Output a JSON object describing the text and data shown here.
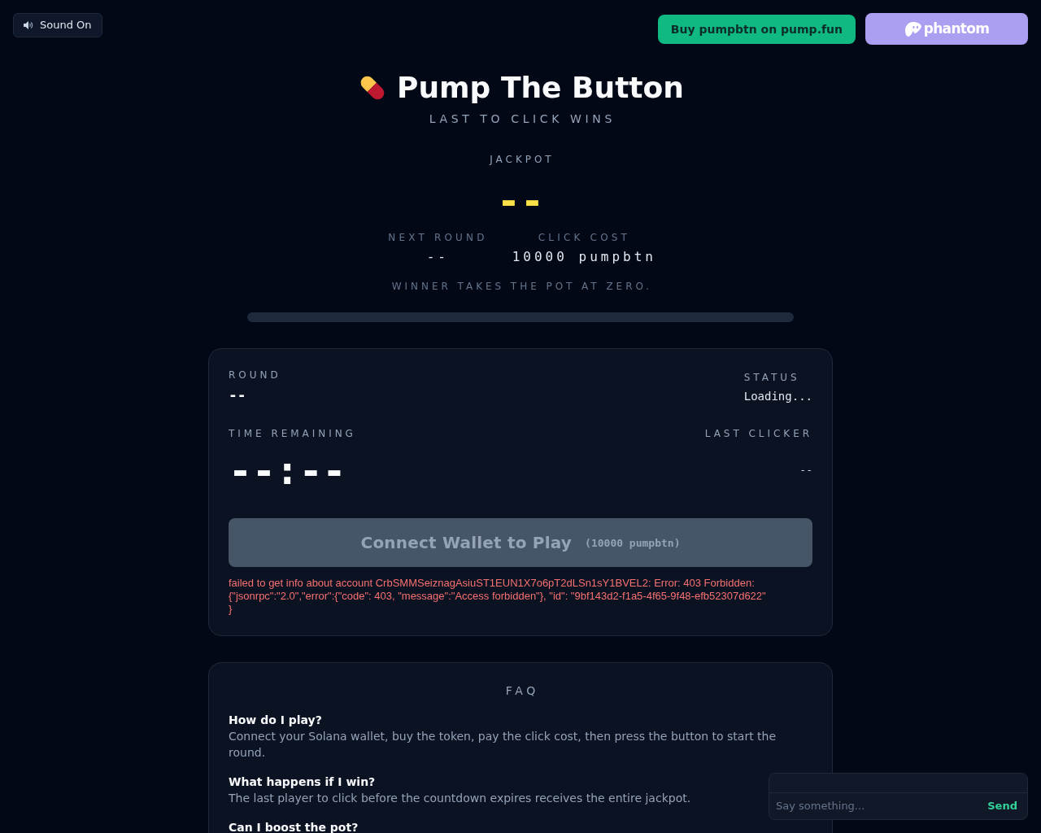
{
  "header": {
    "sound_button": {
      "label": "Sound On",
      "on": true
    },
    "buy_button": {
      "label": "Buy pumpbtn on pump.fun"
    },
    "wallet_button": {
      "label": "phantom"
    }
  },
  "hero": {
    "title": "Pump The Button",
    "subtitle": "LAST TO CLICK WINS",
    "jackpot_label": "JACKPOT",
    "jackpot_value": "--",
    "stats": [
      {
        "label": "NEXT ROUND",
        "value": "--"
      },
      {
        "label": "CLICK COST",
        "value": "10000 pumpbtn"
      }
    ],
    "note": "WINNER TAKES THE POT AT ZERO.",
    "progress": {
      "level": 0
    }
  },
  "round_card": {
    "round": {
      "label": "ROUND",
      "value": "--"
    },
    "status": {
      "label": "STATUS",
      "value": "Loading..."
    },
    "time_remaining": {
      "label": "TIME REMAINING",
      "value": "--:--"
    },
    "last_clicker": {
      "label": "LAST CLICKER",
      "value": "--"
    },
    "play_button": {
      "label": "Connect Wallet to Play",
      "cost": "(10000 pumpbtn)",
      "disabled": true
    },
    "error": "failed to get info about account CrbSMMSeiznagAsiuST1EUN1X7o6pT2dLSn1sY1BVEL2: Error: 403 Forbidden: {\"jsonrpc\":\"2.0\",\"error\":{\"code\": 403, \"message\":\"Access forbidden\"}, \"id\": \"9bf143d2-f1a5-4f65-9f48-efb52307d622\"\n}"
  },
  "faq": {
    "title": "FAQ",
    "items": [
      {
        "question": "How do I play?",
        "answer": "Connect your Solana wallet, buy the token, pay the click cost, then press the button to start the round."
      },
      {
        "question": "What happens if I win?",
        "answer": "The last player to click before the countdown expires receives the entire jackpot."
      },
      {
        "question": "Can I boost the pot?"
      }
    ]
  },
  "chat": {
    "placeholder": "Say something...",
    "send_label": "Send"
  }
}
